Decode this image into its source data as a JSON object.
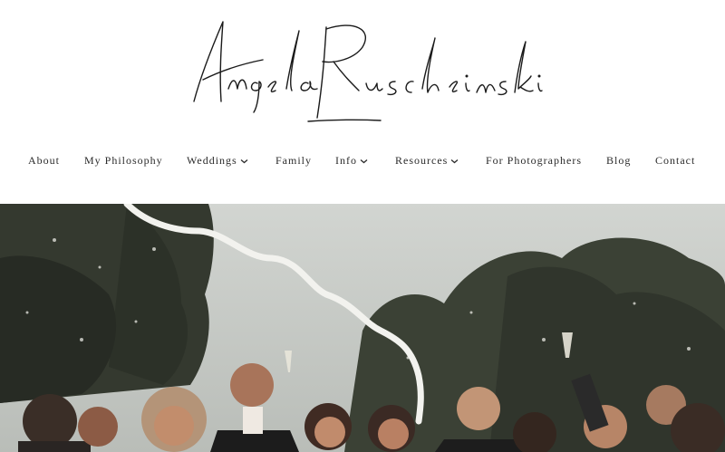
{
  "site": {
    "logo_text": "Angela Ruscheinski"
  },
  "nav": {
    "items": [
      {
        "label": "About",
        "has_dropdown": false
      },
      {
        "label": "My Philosophy",
        "has_dropdown": false
      },
      {
        "label": "Weddings",
        "has_dropdown": true
      },
      {
        "label": "Family",
        "has_dropdown": false
      },
      {
        "label": "Info",
        "has_dropdown": true
      },
      {
        "label": "Resources",
        "has_dropdown": true
      },
      {
        "label": "For Photographers",
        "has_dropdown": false
      },
      {
        "label": "Blog",
        "has_dropdown": false
      },
      {
        "label": "Contact",
        "has_dropdown": false
      }
    ]
  },
  "hero": {
    "icon": "wedding-party-photo",
    "colors": {
      "sky": "#c9cdc9",
      "trees": "#3a3f36",
      "ribbon": "#f2f2ee"
    }
  }
}
